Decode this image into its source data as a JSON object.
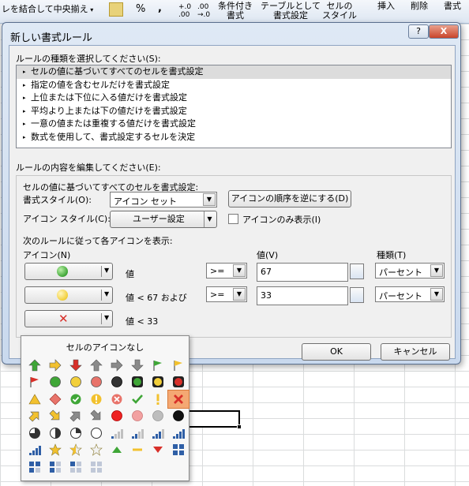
{
  "ribbon": {
    "merge_label": "レを結合して中央揃え",
    "percent": "%",
    "comma": ",",
    "cond_format": [
      "条件付き",
      "書式"
    ],
    "table_format": [
      "テーブルとして",
      "書式設定"
    ],
    "cell_style": [
      "セルの",
      "スタイル"
    ],
    "insert": "挿入",
    "delete": "削除",
    "format": "書式"
  },
  "dialog": {
    "title": "新しい書式ルール",
    "help": "?",
    "close": "X",
    "rule_type_label": "ルールの種類を選択してください(S):",
    "rule_types": [
      "セルの値に基づいてすべてのセルを書式設定",
      "指定の値を含むセルだけを書式設定",
      "上位または下位に入る値だけを書式設定",
      "平均より上または下の値だけを書式設定",
      "一意の値または重複する値だけを書式設定",
      "数式を使用して、書式設定するセルを決定"
    ],
    "edit_label": "ルールの内容を編集してください(E):",
    "group_title": "セルの値に基づいてすべてのセルを書式設定:",
    "format_style_label": "書式スタイル(O):",
    "format_style_value": "アイコン セット",
    "reverse_order_button": "アイコンの順序を逆にする(D)",
    "icon_style_label": "アイコン スタイル(C):",
    "icon_style_value": "ユーザー設定",
    "icon_only_label": "アイコンのみ表示(I)",
    "rules_instruction": "次のルールに従って各アイコンを表示:",
    "col_icon": "アイコン(N)",
    "col_value": "値(V)",
    "col_type": "種類(T)",
    "rows": [
      {
        "icon": "green-circle-icon",
        "text": "値",
        "op": ">=",
        "value": "67",
        "type": "パーセント"
      },
      {
        "icon": "yellow-circle-icon",
        "text": "値 < 67 および",
        "op": ">=",
        "value": "33",
        "type": "パーセント"
      },
      {
        "icon": "red-x-icon",
        "text": "値 < 33"
      }
    ],
    "ok": "OK",
    "cancel": "キャンセル"
  },
  "palette": {
    "title": "セルのアイコンなし",
    "selected_icon": "red-x-icon"
  }
}
